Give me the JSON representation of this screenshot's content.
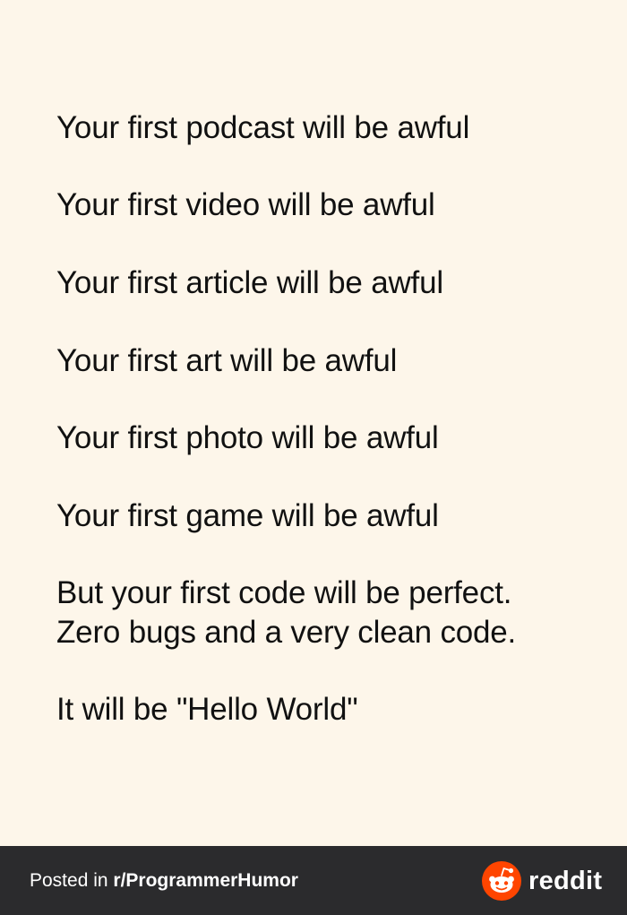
{
  "post": {
    "lines": [
      "Your first podcast will be awful",
      "Your first video will be awful",
      "Your first article will be awful",
      "Your first art will be awful",
      "Your first photo will be awful",
      "Your first game will be awful",
      "But your first code will be perfect.",
      "Zero bugs and a very clean code.",
      "It will be \"Hello World\""
    ]
  },
  "footer": {
    "posted_prefix": "Posted in ",
    "subreddit": "r/ProgrammerHumor",
    "brand": "reddit",
    "brand_icon": "reddit-snoo-icon",
    "brand_color": "#ff4500",
    "bar_color": "#2b2b2d"
  }
}
